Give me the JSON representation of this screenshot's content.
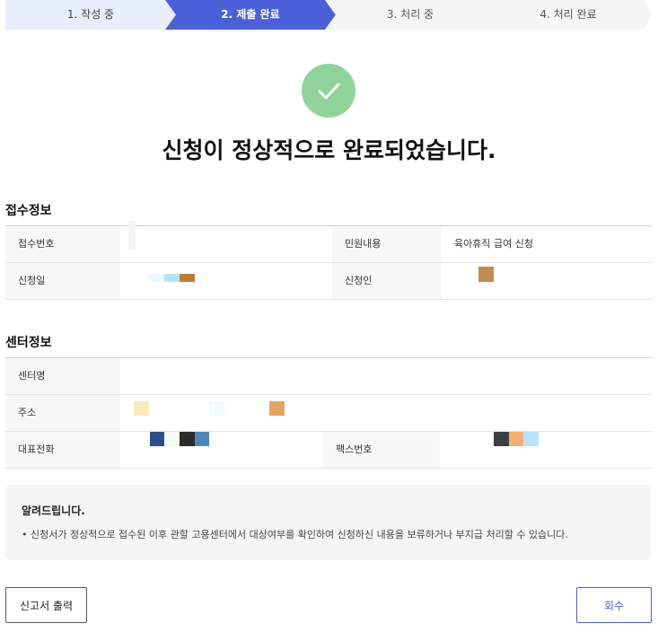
{
  "stepper": {
    "steps": [
      {
        "label": "1. 작성 중"
      },
      {
        "label": "2. 제출 완료"
      },
      {
        "label": "3. 처리 중"
      },
      {
        "label": "4. 처리 완료"
      }
    ]
  },
  "success": {
    "icon": "check-icon",
    "color": "#8fd39a",
    "title": "신청이 정상적으로 완료되었습니다."
  },
  "receipt": {
    "title": "접수정보",
    "number_label": "접수번호",
    "number_value": "",
    "content_label": "민원내용",
    "content_value": "육아휴직 급여 신청",
    "date_label": "신청일",
    "date_value": "",
    "applicant_label": "신청인",
    "applicant_value": ""
  },
  "center": {
    "title": "센터정보",
    "name_label": "센터명",
    "name_value": "",
    "address_label": "주소",
    "address_value": "",
    "phone_label": "대표전화",
    "phone_value": "",
    "fax_label": "팩스번호",
    "fax_value": ""
  },
  "notice": {
    "title": "알려드립니다.",
    "text": "• 신청서가 정상적으로 접수된 이후 관할 고용센터에서 대상여부를 확인하여 신청하신 내용을 보류하거나 부지급 처리할 수 있습니다."
  },
  "buttons": {
    "print_label": "신고서 출력",
    "withdraw_label": "회수"
  },
  "colors": {
    "accent": "#4b5fd9",
    "success": "#8fd39a"
  }
}
